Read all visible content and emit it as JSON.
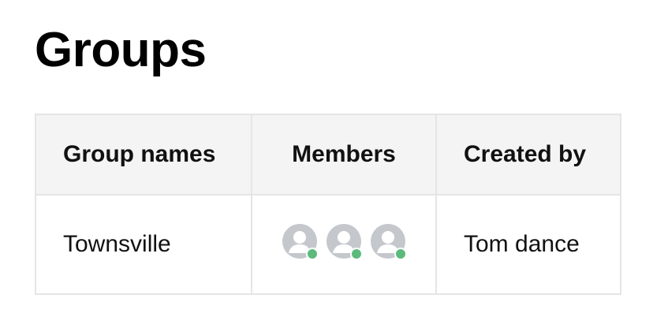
{
  "page": {
    "title": "Groups"
  },
  "table": {
    "columns": [
      "Group names",
      "Members",
      "Created by"
    ],
    "rows": [
      {
        "group_name": "Townsville",
        "members": [
          {
            "icon": "user-avatar-icon",
            "status": "online"
          },
          {
            "icon": "user-avatar-icon",
            "status": "online"
          },
          {
            "icon": "user-avatar-icon",
            "status": "online"
          }
        ],
        "created_by": "Tom dance"
      }
    ]
  },
  "colors": {
    "avatar": "#c4c7cc",
    "online": "#5dba7d",
    "header_bg": "#f4f4f4",
    "border": "#e5e5e5"
  }
}
